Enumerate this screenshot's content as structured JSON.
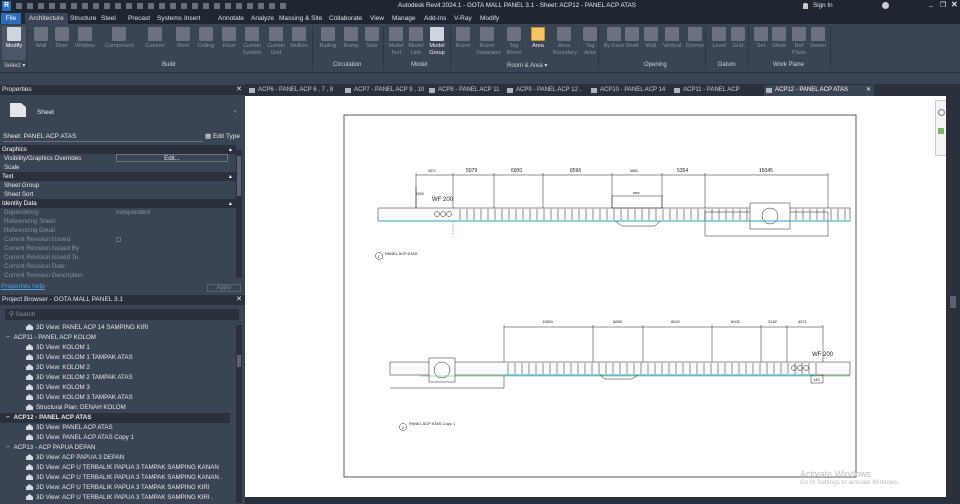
{
  "title": "Autodesk Revit 2024.1 - GOTA MALL PANEL 3.1 - Sheet: ACP12 - PANEL ACP ATAS",
  "sign_in": "Sign In",
  "menu_tabs": [
    "File",
    "Architecture",
    "Structure",
    "Steel",
    "Precast",
    "Systems",
    "Insert",
    "Annotate",
    "Analyze",
    "Massing & Site",
    "Collaborate",
    "View",
    "Manage",
    "Add-Ins",
    "V-Ray",
    "Modify"
  ],
  "ribbon": {
    "buttons": [
      "Modify",
      "Wall",
      "Door",
      "Window",
      "Component",
      "Column",
      "Roof",
      "Ceiling",
      "Floor",
      "Curtain System",
      "Curtain Grid",
      "Mullion",
      "Railing",
      "Ramp",
      "Stair",
      "Model Text",
      "Model Line",
      "Model Group",
      "Room",
      "Room Separator",
      "Tag Room",
      "Area",
      "Area Boundary",
      "Tag Area",
      "By Face",
      "Shaft",
      "Wall",
      "Vertical",
      "Dormer",
      "Level",
      "Grid",
      "Set",
      "Show",
      "Ref Plane",
      "Viewer"
    ],
    "panels": [
      "Select ▾",
      "Build",
      "Circulation",
      "Model",
      "Room & Area ▾",
      "Opening",
      "Datum",
      "Work Plane"
    ]
  },
  "properties": {
    "header": "Properties",
    "type": "Sheet",
    "instance": "Sheet: PANEL ACP ATAS",
    "edit_type": "Edit Type",
    "rows": [
      {
        "label": "Graphics",
        "group": true
      },
      {
        "label": "Visibility/Graphics Overrides",
        "value": "Edit..."
      },
      {
        "label": "Scale",
        "value": ""
      },
      {
        "label": "Text",
        "group": true
      },
      {
        "label": "Sheet Group",
        "value": ""
      },
      {
        "label": "Sheet Sort",
        "value": ""
      },
      {
        "label": "Identity Data",
        "group": true
      },
      {
        "label": "Dependency",
        "value": "Independent"
      },
      {
        "label": "Referencing Sheet",
        "value": ""
      },
      {
        "label": "Referencing Detail",
        "value": ""
      },
      {
        "label": "Current Revision Issued",
        "value": ""
      },
      {
        "label": "Current Revision Issued By",
        "value": ""
      },
      {
        "label": "Current Revision Issued To",
        "value": ""
      },
      {
        "label": "Current Revision Date",
        "value": ""
      },
      {
        "label": "Current Revision Description",
        "value": ""
      }
    ],
    "help": "Properties help",
    "apply": "Apply"
  },
  "browser": {
    "header": "Project Browser - GOTA MALL PANEL 3.1",
    "search_placeholder": "Search",
    "items": [
      {
        "t": "3D View: PANEL ACP 14 SAMPING KIRI",
        "lvl": 2
      },
      {
        "t": "ACP11 - PANEL ACP KOLOM",
        "lvl": 1
      },
      {
        "t": "3D View: KOLOM 1",
        "lvl": 2
      },
      {
        "t": "3D View: KOLOM 1 TAMPAK ATAS",
        "lvl": 2
      },
      {
        "t": "3D View: KOLOM 2",
        "lvl": 2
      },
      {
        "t": "3D View: KOLOM 2 TAMPAK ATAS",
        "lvl": 2
      },
      {
        "t": "3D View: KOLOM 3",
        "lvl": 2
      },
      {
        "t": "3D View: KOLOM 3 TAMPAK ATAS",
        "lvl": 2
      },
      {
        "t": "Structural Plan: DENAH KOLOM",
        "lvl": 2
      },
      {
        "t": "ACP12 - PANEL ACP ATAS",
        "lvl": 1,
        "sel": true
      },
      {
        "t": "3D View: PANEL ACP ATAS",
        "lvl": 2
      },
      {
        "t": "3D View: PANEL ACP ATAS Copy 1",
        "lvl": 2
      },
      {
        "t": "ACP13 - ACP PAPUA DEPAN",
        "lvl": 1
      },
      {
        "t": "3D View: ACP PAPUA 3 DEPAN",
        "lvl": 2
      },
      {
        "t": "3D View: ACP U TERBALIK PAPUA 3 TAMPAK SAMPING KANAN",
        "lvl": 2
      },
      {
        "t": "3D View: ACP U TERBALIK PAPUA 3 TAMPAK SAMPING KANAN .",
        "lvl": 2
      },
      {
        "t": "3D View: ACP U TERBALIK PAPUA 3 TAMPAK SAMPING KIRI",
        "lvl": 2
      },
      {
        "t": "3D View: ACP U TERBALIK PAPUA 3 TAMPAK SAMPING KIRI .",
        "lvl": 2
      }
    ]
  },
  "doc_tabs": [
    "ACP6 - PANEL ACP 6 , 7 , 8",
    "ACP7 - PANEL ACP 9 , 10",
    "ACP8 - PANEL ACP 11",
    "ACP9 - PANEL ACP 12 , 13",
    "ACP10 - PANEL ACP 14",
    "ACP11 - PANEL ACP KOLOM",
    "ACP12 - PANEL ACP ATAS"
  ],
  "drawing": {
    "view1": {
      "title": "PANEL ACP ATAS",
      "num": "1",
      "dims": [
        "4571",
        "5079",
        "6000",
        "8596",
        "6855",
        "5354",
        "15045"
      ],
      "wf": "WF 200",
      "sub": "1500",
      "inner": "6855",
      "marks": [
        "150",
        "100",
        "200",
        "100",
        "400",
        "100",
        "150",
        "2500",
        "150"
      ]
    },
    "view2": {
      "title": "PANEL ACP ATAS Copy 1",
      "num": "2",
      "dims": [
        "11850",
        "6855",
        "8542",
        "6000",
        "3182",
        "4571"
      ],
      "wf": "WF 200",
      "sub": "140"
    }
  },
  "watermark": {
    "line1": "Activate Windows",
    "line2": "Go to Settings to activate Windows."
  }
}
